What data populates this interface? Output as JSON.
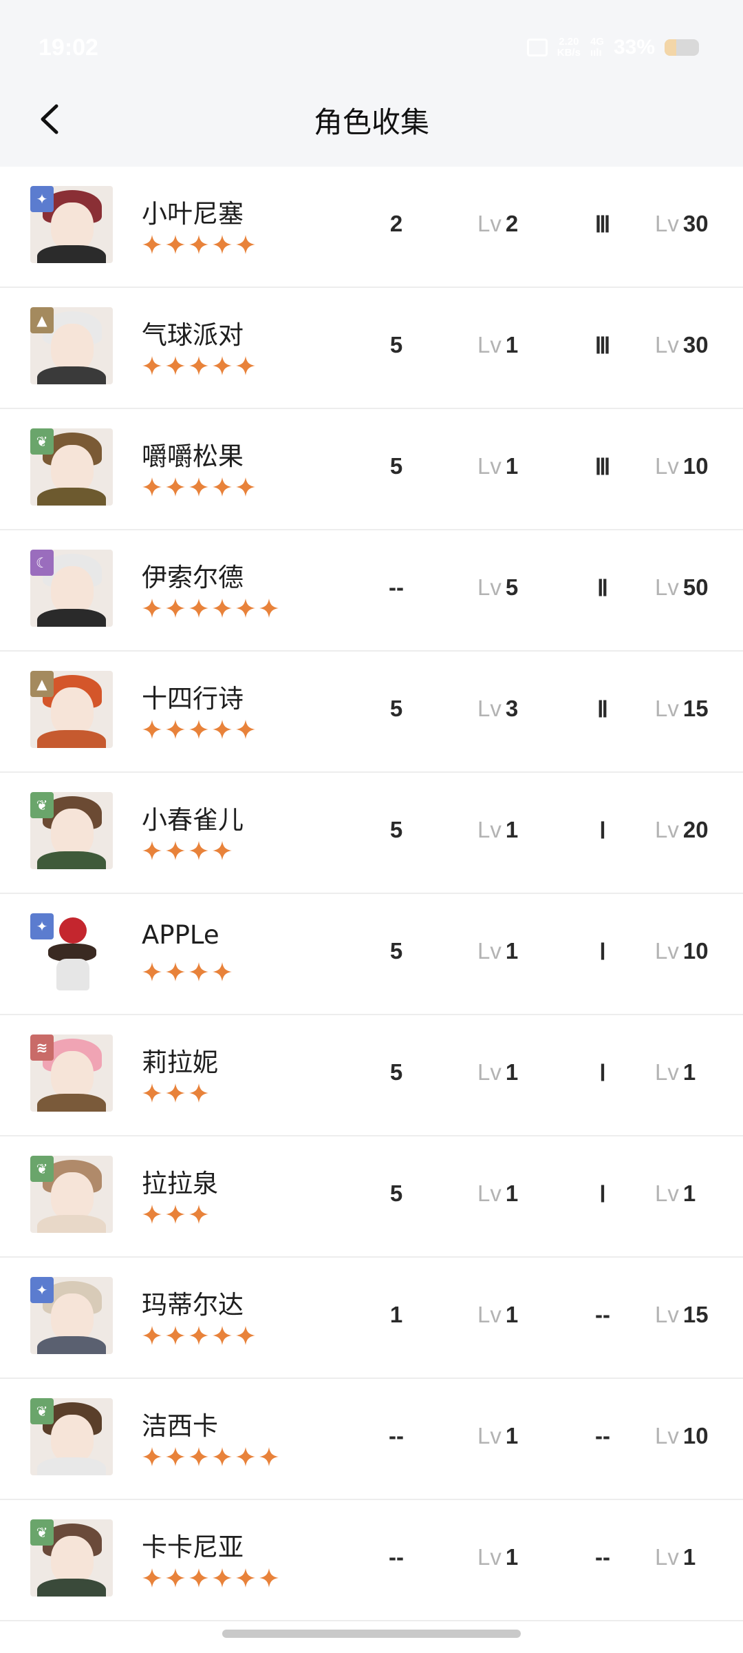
{
  "status_bar": {
    "time": "19:02",
    "net_speed_value": "2.20",
    "net_speed_unit": "KB/s",
    "signal_label": "4G",
    "signal_sub": "ıılı",
    "battery_percent": "33%",
    "battery_level": 0.33
  },
  "header": {
    "title": "角色收集",
    "back_icon": "chevron-left-icon"
  },
  "colors": {
    "star": "#e8823a",
    "badge_star": "#5b7ccf",
    "badge_rock": "#a48a5e",
    "badge_plant": "#6aa56b",
    "badge_mystic": "#9a6dbd",
    "badge_beast": "#c96b68"
  },
  "characters": [
    {
      "name": "小叶尼塞",
      "stars": 5,
      "badge": "star",
      "c1": "2",
      "lv1": "2",
      "rank": "Ⅲ",
      "lv2": "30"
    },
    {
      "name": "气球派对",
      "stars": 5,
      "badge": "rock",
      "c1": "5",
      "lv1": "1",
      "rank": "Ⅲ",
      "lv2": "30"
    },
    {
      "name": "嚼嚼松果",
      "stars": 5,
      "badge": "plant",
      "c1": "5",
      "lv1": "1",
      "rank": "Ⅲ",
      "lv2": "10"
    },
    {
      "name": "伊索尔德",
      "stars": 6,
      "badge": "mystic",
      "c1": "--",
      "lv1": "5",
      "rank": "Ⅱ",
      "lv2": "50"
    },
    {
      "name": "十四行诗",
      "stars": 5,
      "badge": "rock",
      "c1": "5",
      "lv1": "3",
      "rank": "Ⅱ",
      "lv2": "15"
    },
    {
      "name": "小春雀儿",
      "stars": 4,
      "badge": "plant",
      "c1": "5",
      "lv1": "1",
      "rank": "Ⅰ",
      "lv2": "20"
    },
    {
      "name": "APPLe",
      "stars": 4,
      "badge": "star",
      "c1": "5",
      "lv1": "1",
      "rank": "Ⅰ",
      "lv2": "10"
    },
    {
      "name": "莉拉妮",
      "stars": 3,
      "badge": "beast",
      "c1": "5",
      "lv1": "1",
      "rank": "Ⅰ",
      "lv2": "1"
    },
    {
      "name": "拉拉泉",
      "stars": 3,
      "badge": "plant",
      "c1": "5",
      "lv1": "1",
      "rank": "Ⅰ",
      "lv2": "1"
    },
    {
      "name": "玛蒂尔达",
      "stars": 5,
      "badge": "star",
      "c1": "1",
      "lv1": "1",
      "rank": "--",
      "lv2": "15"
    },
    {
      "name": "洁西卡",
      "stars": 6,
      "badge": "plant",
      "c1": "--",
      "lv1": "1",
      "rank": "--",
      "lv2": "10"
    },
    {
      "name": "卡卡尼亚",
      "stars": 6,
      "badge": "plant",
      "c1": "--",
      "lv1": "1",
      "rank": "--",
      "lv2": "1"
    }
  ],
  "lv_prefix": "Lv"
}
